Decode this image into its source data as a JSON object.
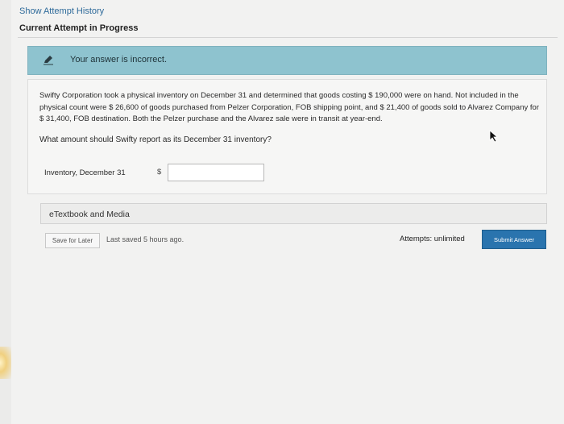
{
  "header": {
    "show_attempt_history": "Show Attempt History",
    "current_attempt": "Current Attempt in Progress"
  },
  "feedback": {
    "message": "Your answer is incorrect.",
    "icon": "pencil-icon",
    "color": "#8ec3cf"
  },
  "problem": {
    "paragraph": "Swifty Corporation took a physical inventory on December 31 and determined that goods costing $ 190,000 were on hand. Not included in the physical count were $ 26,600 of goods purchased from Pelzer Corporation, FOB shipping point, and $ 21,400 of goods sold to Alvarez Company for $ 31,400, FOB destination. Both the Pelzer purchase and the Alvarez sale were in transit at year-end.",
    "question": "What amount should Swifty report as its December 31 inventory?",
    "inventory_label": "Inventory, December 31",
    "currency": "$",
    "inventory_value": ""
  },
  "resources": {
    "etextbook_label": "eTextbook and Media"
  },
  "footer": {
    "save_label": "Save for Later",
    "last_saved": "Last saved 5 hours ago.",
    "attempts": "Attempts: unlimited",
    "submit_label": "Submit Answer",
    "submit_color": "#2a74ae"
  }
}
